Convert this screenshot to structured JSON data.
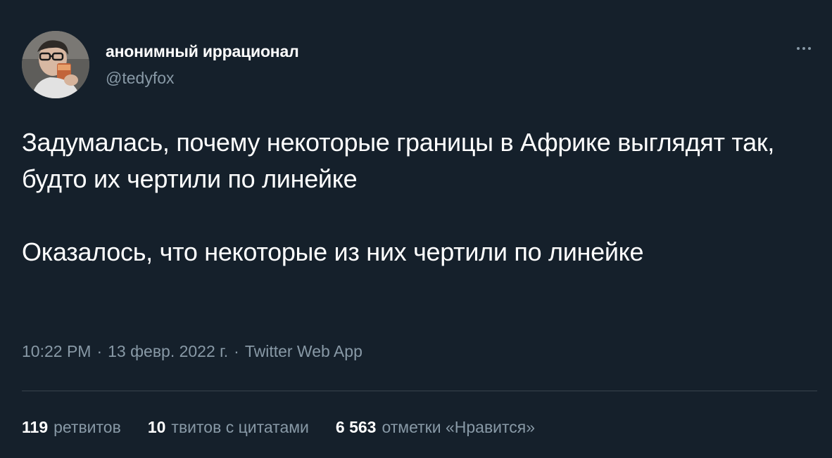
{
  "author": {
    "display_name": "анонимный иррационал",
    "handle": "@tedyfox",
    "avatar_icon": "user-avatar-photo"
  },
  "more_icon": "more-options-icon",
  "tweet": {
    "paragraphs": [
      "Задумалась, почему некоторые границы в Африке выглядят так, будто их чертили по линейке",
      "Оказалось, что некоторые из них чертили по линейке"
    ]
  },
  "meta": {
    "time": "10:22 PM",
    "separator": "·",
    "date": "13 февр. 2022 г.",
    "source": "Twitter Web App"
  },
  "stats": {
    "retweets": {
      "count": "119",
      "label": "ретвитов"
    },
    "quotes": {
      "count": "10",
      "label": "твитов с цитатами"
    },
    "likes": {
      "count": "6 563",
      "label": "отметки «Нравится»"
    }
  },
  "colors": {
    "background": "#15202b",
    "primary_text": "#ffffff",
    "secondary_text": "#8899a6",
    "divider": "#38444d"
  }
}
